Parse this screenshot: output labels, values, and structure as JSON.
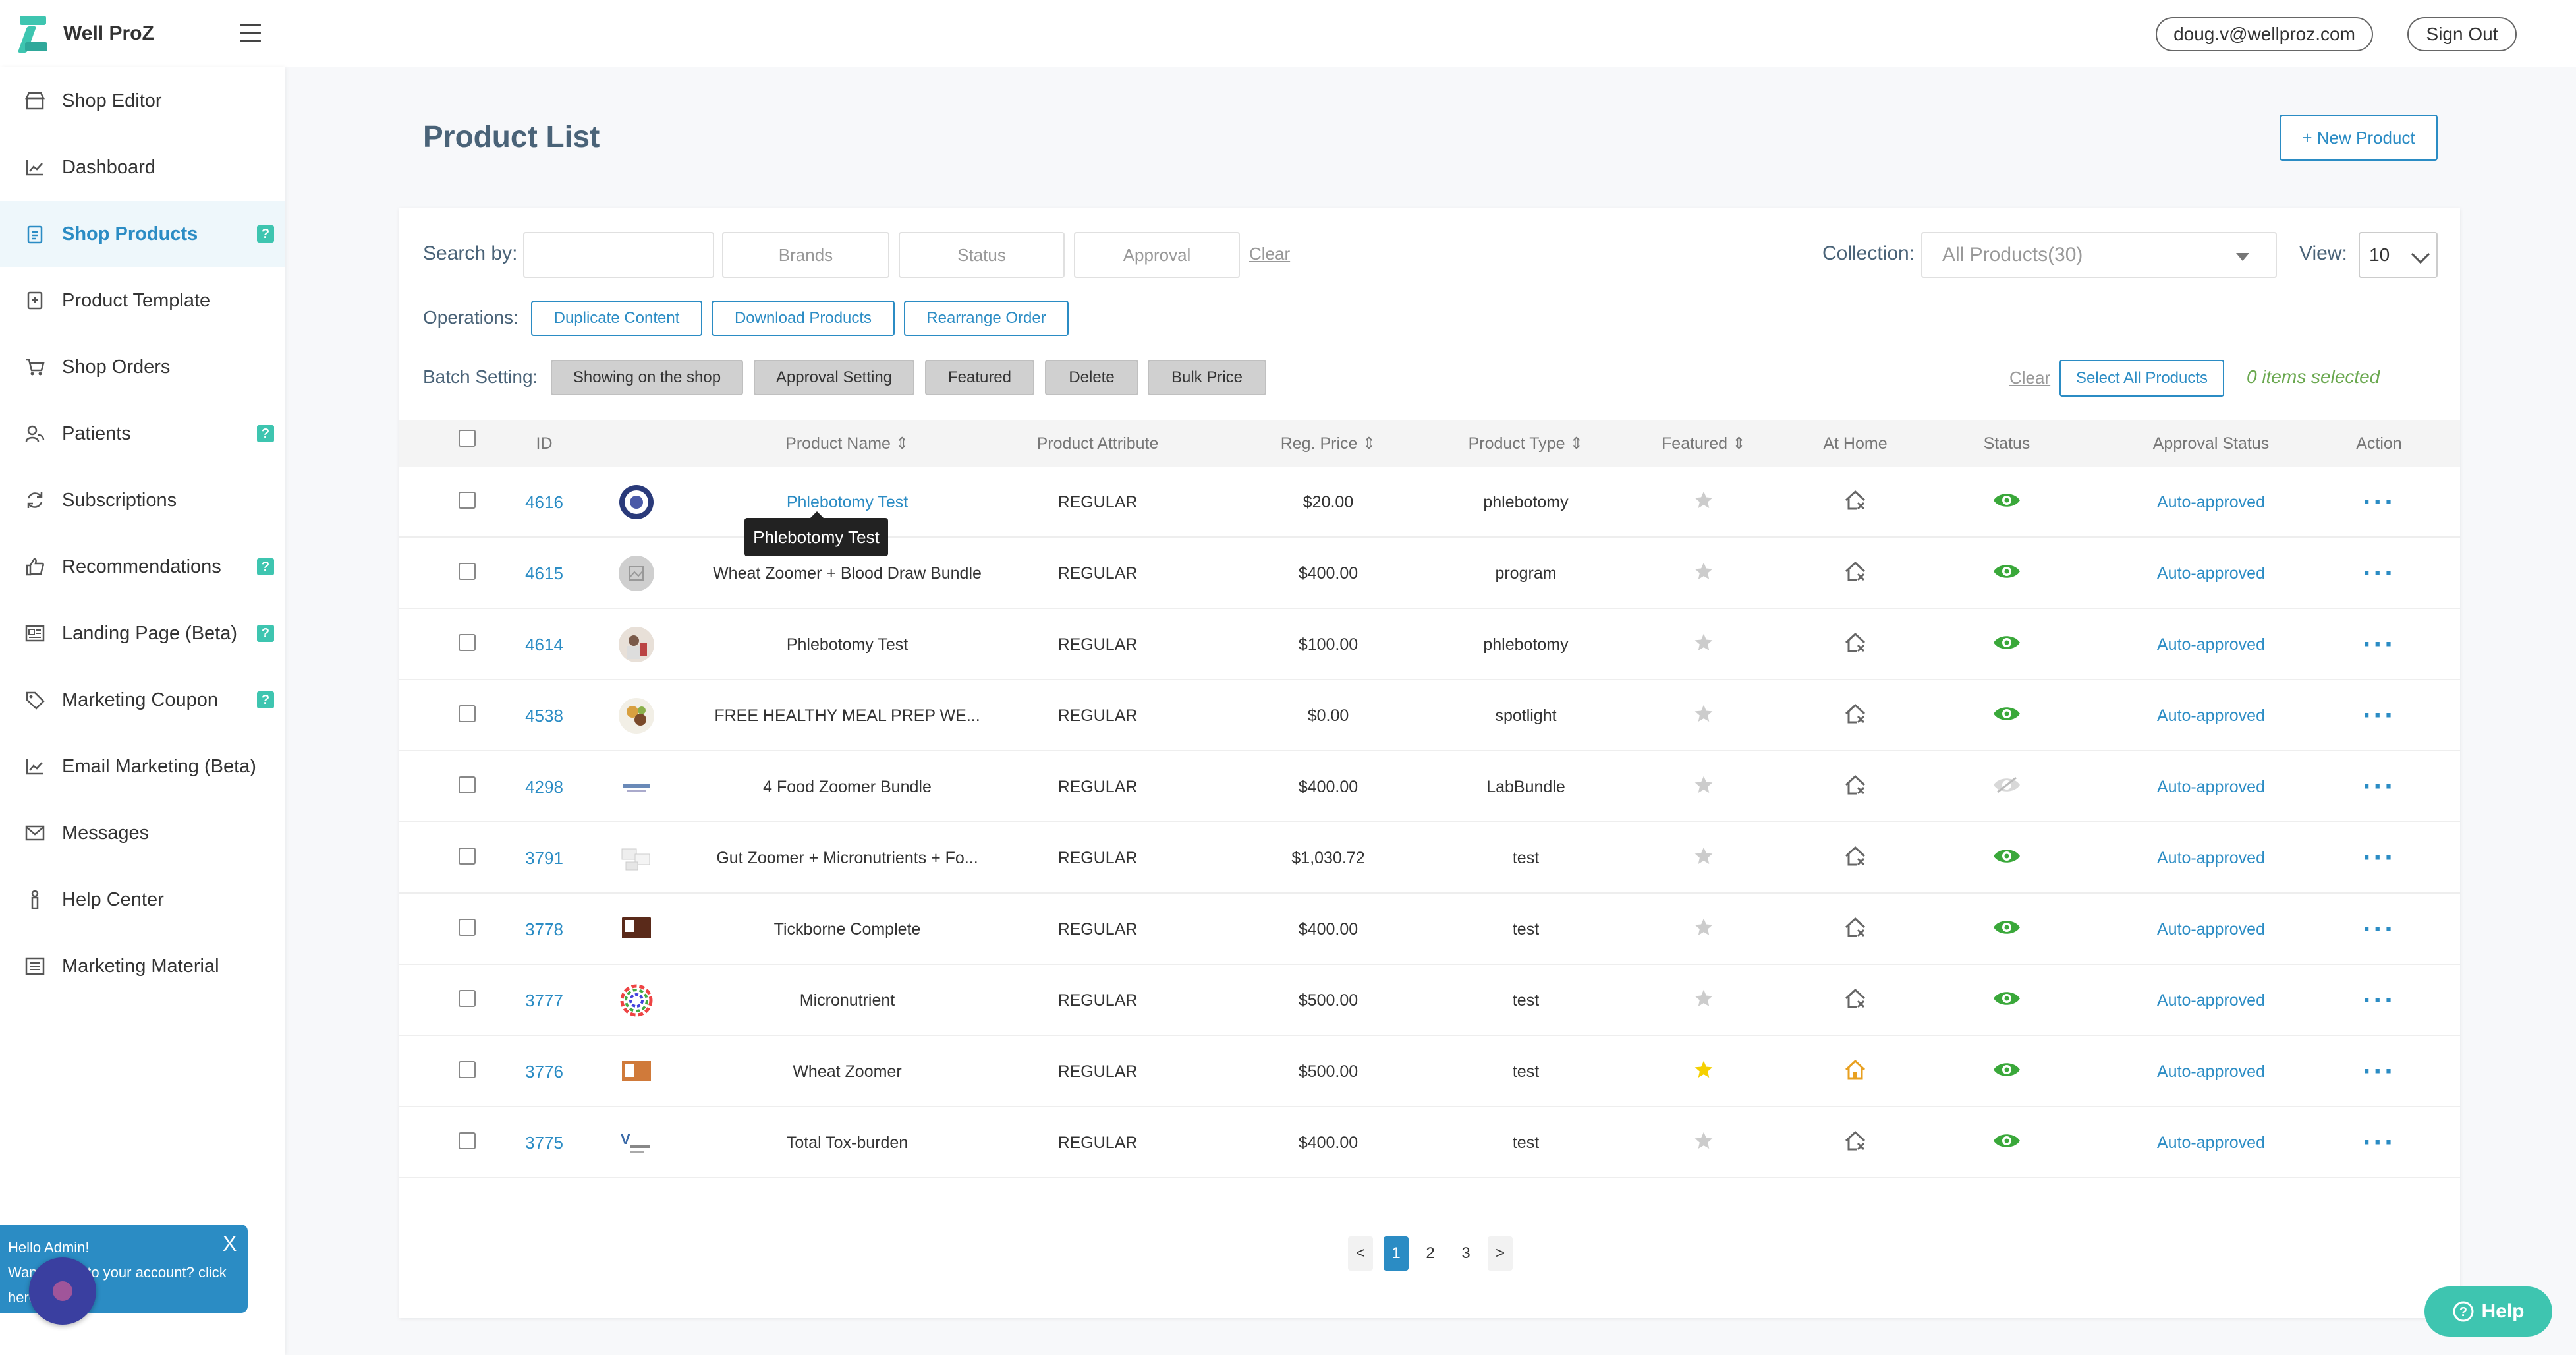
{
  "app": {
    "name": "Well ProZ",
    "user_email": "doug.v@wellproz.com",
    "sign_out": "Sign Out"
  },
  "sidebar": {
    "items": [
      {
        "label": "Shop Editor",
        "icon": "store-icon",
        "help": false
      },
      {
        "label": "Dashboard",
        "icon": "chart-icon",
        "help": false
      },
      {
        "label": "Shop Products",
        "icon": "clipboard-icon",
        "help": true,
        "active": true
      },
      {
        "label": "Product Template",
        "icon": "template-icon",
        "help": false
      },
      {
        "label": "Shop Orders",
        "icon": "cart-icon",
        "help": false
      },
      {
        "label": "Patients",
        "icon": "users-icon",
        "help": true
      },
      {
        "label": "Subscriptions",
        "icon": "refresh-icon",
        "help": false
      },
      {
        "label": "Recommendations",
        "icon": "thumbs-up-icon",
        "help": true
      },
      {
        "label": "Landing Page (Beta)",
        "icon": "landing-icon",
        "help": true
      },
      {
        "label": "Marketing Coupon",
        "icon": "tag-icon",
        "help": true
      },
      {
        "label": "Email Marketing (Beta)",
        "icon": "chart-icon",
        "help": false
      },
      {
        "label": "Messages",
        "icon": "mail-icon",
        "help": false
      },
      {
        "label": "Help Center",
        "icon": "help-icon",
        "help": false
      },
      {
        "label": "Marketing Material",
        "icon": "list-icon",
        "help": false
      }
    ],
    "help_badge": "?"
  },
  "page": {
    "title": "Product List",
    "new_product": "+ New Product"
  },
  "filters": {
    "search_label": "Search by:",
    "search_value": "",
    "brands": "Brands",
    "status": "Status",
    "approval": "Approval",
    "clear": "Clear",
    "collection_label": "Collection:",
    "collection_value": "All Products(30)",
    "view_label": "View:",
    "view_value": "10"
  },
  "operations": {
    "label": "Operations:",
    "buttons": [
      "Duplicate Content",
      "Download Products",
      "Rearrange Order"
    ]
  },
  "batch": {
    "label": "Batch Setting:",
    "buttons": [
      "Showing on the shop",
      "Approval Setting",
      "Featured",
      "Delete",
      "Bulk Price"
    ],
    "clear": "Clear",
    "select_all": "Select All Products",
    "selected": "0 items selected"
  },
  "table": {
    "headers": {
      "id": "ID",
      "name": "Product Name ⇕",
      "attribute": "Product Attribute",
      "price": "Reg. Price ⇕",
      "type": "Product Type ⇕",
      "featured": "Featured ⇕",
      "home": "At Home",
      "status": "Status",
      "approval": "Approval Status",
      "action": "Action"
    },
    "rows": [
      {
        "id": "4616",
        "name": "Phlebotomy Test",
        "attribute": "REGULAR",
        "price": "$20.00",
        "type": "phlebotomy",
        "featured": false,
        "home": false,
        "visible": true,
        "approval": "Auto-approved",
        "thumb": "seal"
      },
      {
        "id": "4615",
        "name": "Wheat Zoomer + Blood Draw Bundle",
        "attribute": "REGULAR",
        "price": "$400.00",
        "type": "program",
        "featured": false,
        "home": false,
        "visible": true,
        "approval": "Auto-approved",
        "thumb": "placeholder"
      },
      {
        "id": "4614",
        "name": "Phlebotomy Test",
        "attribute": "REGULAR",
        "price": "$100.00",
        "type": "phlebotomy",
        "featured": false,
        "home": false,
        "visible": true,
        "approval": "Auto-approved",
        "thumb": "person"
      },
      {
        "id": "4538",
        "name": "FREE HEALTHY MEAL PREP WE...",
        "attribute": "REGULAR",
        "price": "$0.00",
        "type": "spotlight",
        "featured": false,
        "home": false,
        "visible": true,
        "approval": "Auto-approved",
        "thumb": "food"
      },
      {
        "id": "4298",
        "name": "4 Food Zoomer Bundle",
        "attribute": "REGULAR",
        "price": "$400.00",
        "type": "LabBundle",
        "featured": false,
        "home": false,
        "visible": false,
        "approval": "Auto-approved",
        "thumb": "text"
      },
      {
        "id": "3791",
        "name": "Gut Zoomer + Micronutrients + Fo...",
        "attribute": "REGULAR",
        "price": "$1,030.72",
        "type": "test",
        "featured": false,
        "home": false,
        "visible": true,
        "approval": "Auto-approved",
        "thumb": "boxes"
      },
      {
        "id": "3778",
        "name": "Tickborne Complete",
        "attribute": "REGULAR",
        "price": "$400.00",
        "type": "test",
        "featured": false,
        "home": false,
        "visible": true,
        "approval": "Auto-approved",
        "thumb": "box-brown"
      },
      {
        "id": "3777",
        "name": "Micronutrient",
        "attribute": "REGULAR",
        "price": "$500.00",
        "type": "test",
        "featured": false,
        "home": false,
        "visible": true,
        "approval": "Auto-approved",
        "thumb": "wheel"
      },
      {
        "id": "3776",
        "name": "Wheat Zoomer",
        "attribute": "REGULAR",
        "price": "$500.00",
        "type": "test",
        "featured": true,
        "home": true,
        "visible": true,
        "approval": "Auto-approved",
        "thumb": "box-orange"
      },
      {
        "id": "3775",
        "name": "Total Tox-burden",
        "attribute": "REGULAR",
        "price": "$400.00",
        "type": "test",
        "featured": false,
        "home": false,
        "visible": true,
        "approval": "Auto-approved",
        "thumb": "vibrant"
      }
    ]
  },
  "tooltip": "Phlebotomy Test",
  "pagination": {
    "prev": "<",
    "pages": [
      "1",
      "2",
      "3"
    ],
    "current": "1",
    "next": ">"
  },
  "help_button": "Help",
  "chat": {
    "greeting": "Hello Admin!",
    "line2": "Want to link to your account? click",
    "line3": "here",
    "close": "X"
  },
  "colors": {
    "accent": "#2b8cc4",
    "brand": "#3ec5b0",
    "visible": "#3aa83a",
    "featured": "#f5d000"
  }
}
